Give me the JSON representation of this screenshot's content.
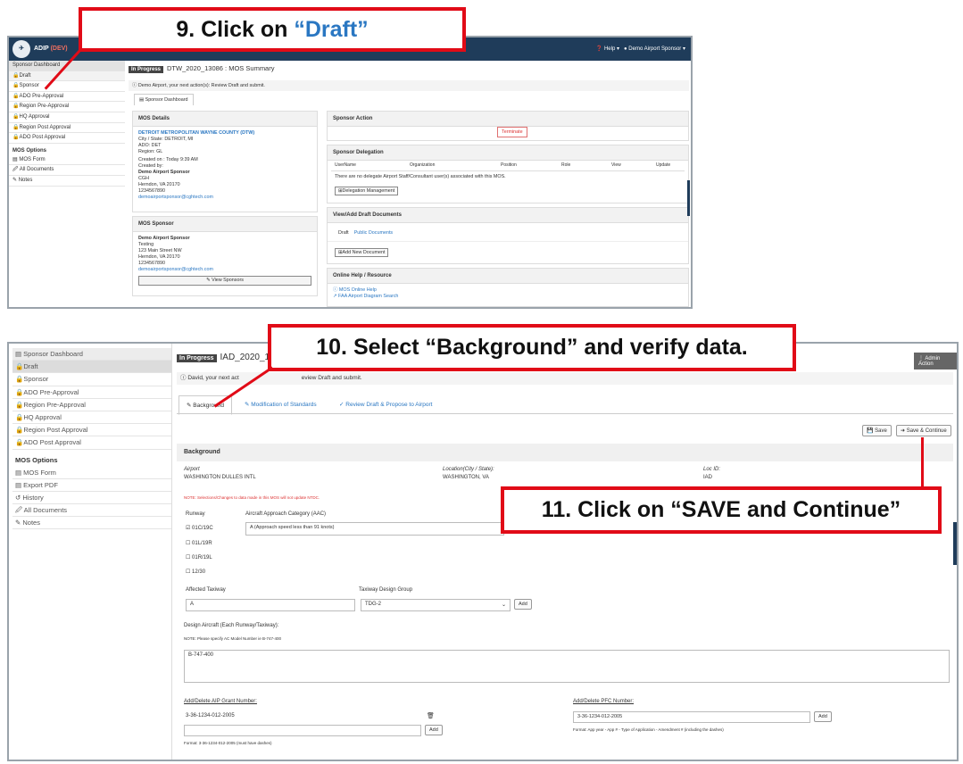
{
  "callouts": {
    "c9_prefix": "9. Click on ",
    "c9_highlight": "“Draft”",
    "c10": "10. Select “Background” and verify data.",
    "c11": "11. Click on “SAVE and Continue”"
  },
  "s1": {
    "app": "ADIP",
    "app_env": "(DEV)",
    "help": "❓ Help ▾",
    "user": "Demo Airport Sponsor ▾",
    "sidebar": [
      "Sponsor Dashboard",
      "Draft",
      "Sponsor",
      "ADO Pre-Approval",
      "Region Pre-Approval",
      "HQ Approval",
      "Region Post Approval",
      "ADO Post Approval"
    ],
    "mos_options_title": "MOS Options",
    "mos_options": [
      "MOS Form",
      "All Documents",
      "Notes"
    ],
    "status": "In Progress",
    "title": "DTW_2020_13086 : MOS Summary",
    "notice": "Demo Airport, your next action(s): Review Draft and submit.",
    "tab": "Sponsor Dashboard",
    "mos_details": {
      "head": "MOS Details",
      "airport": "DETROIT METROPOLITAN WAYNE COUNTY (DTW)",
      "city": "City / State: DETROIT, MI",
      "ado": "ADO: DET",
      "region": "Region: GL",
      "created_on": "Created on : Today 9:39 AM",
      "created_by": "Created by:",
      "sponsor": "Demo Airport Sponsor",
      "org": "CGH",
      "addr": "Herndon, VA 20170",
      "phone": "1234567890",
      "email": "demoairportsponsor@cghtech.com"
    },
    "mos_sponsor": {
      "head": "MOS Sponsor",
      "name": "Demo Airport Sponsor",
      "l1": "Testing",
      "l2": "123 Main Street NW",
      "l3": "Herndon, VA 20170",
      "l4": "1234567890",
      "email": "demoairportsponsor@cghtech.com",
      "btn": "View Sponsors"
    },
    "sponsor_action": {
      "head": "Sponsor Action",
      "btn": "Terminate"
    },
    "delegation": {
      "head": "Sponsor Delegation",
      "cols": [
        "UserName",
        "Organization",
        "Position",
        "Role",
        "View",
        "Update"
      ],
      "empty": "There are no delegate Airport Staff/Consultant user(s) associated with this MOS.",
      "btn": "Delegation Management"
    },
    "draft_docs": {
      "head": "View/Add Draft Documents",
      "tab1": "Draft",
      "tab2": "Public Documents",
      "btn": "Add New Document"
    },
    "online_help": {
      "head": "Online Help / Resource",
      "l1": "MOS Online Help",
      "l2": "FAA Airport Diagram Search"
    }
  },
  "s2": {
    "sidebar": [
      "Sponsor Dashboard",
      "Draft",
      "Sponsor",
      "ADO Pre-Approval",
      "Region Pre-Approval",
      "HQ Approval",
      "Region Post Approval",
      "ADO Post Approval"
    ],
    "mos_options_title": "MOS Options",
    "mos_options": [
      "MOS Form",
      "Export PDF",
      "History",
      "All Documents",
      "Notes"
    ],
    "status": "In Progress",
    "title": "IAD_2020_1",
    "admin": "Admin Action",
    "notice": "David, your next act",
    "notice_tail": "eview Draft and submit.",
    "tabs": [
      "Background",
      "Modification of Standards",
      "Review Draft & Propose to Airport"
    ],
    "save": "Save",
    "save_continue": "Save & Continue",
    "section": "Background",
    "airport_lbl": "Airport",
    "airport": "WASHINGTON DULLES INTL",
    "loc_lbl": "Location(City / State):",
    "loc": "WASHINGTON, VA",
    "locid_lbl": "Loc ID:",
    "locid": "IAD",
    "note": "NOTE: Selections/Changes to data made in this MOS will not update NTDC.",
    "runway_lbl": "Runway",
    "runways": [
      "☑ 01C/19C",
      "☐ 01L/19R",
      "☐ 01R/19L",
      "☐ 12/30"
    ],
    "aac_lbl": "Aircraft Approach Category (AAC)",
    "aac": "A (Approach speed less than 91 knots)",
    "taxiway_lbl": "Affected Taxiway",
    "taxiway": "A",
    "tdg_lbl": "Taxiway Design Group",
    "tdg": "TDG-2",
    "add": "Add",
    "design_lbl": "Design Aircraft (Each Runway/Taxiway):",
    "design_note": "NOTE: Please specify AC Model Number ie B-747-400",
    "design_val": "B-747-400",
    "aip_lbl": "Add/Delete AIP Grant Number:",
    "aip": "3-36-1234-012-2005",
    "aip_format": "Format: 3-36-1234-012-2005 (must have dashes)",
    "pfc_lbl": "Add/Delete PFC Number:",
    "pfc": "3-36-1234-012-2005",
    "pfc_format": "Format: App year - App # - Type of Application - Amendment # (including the dashes)"
  }
}
